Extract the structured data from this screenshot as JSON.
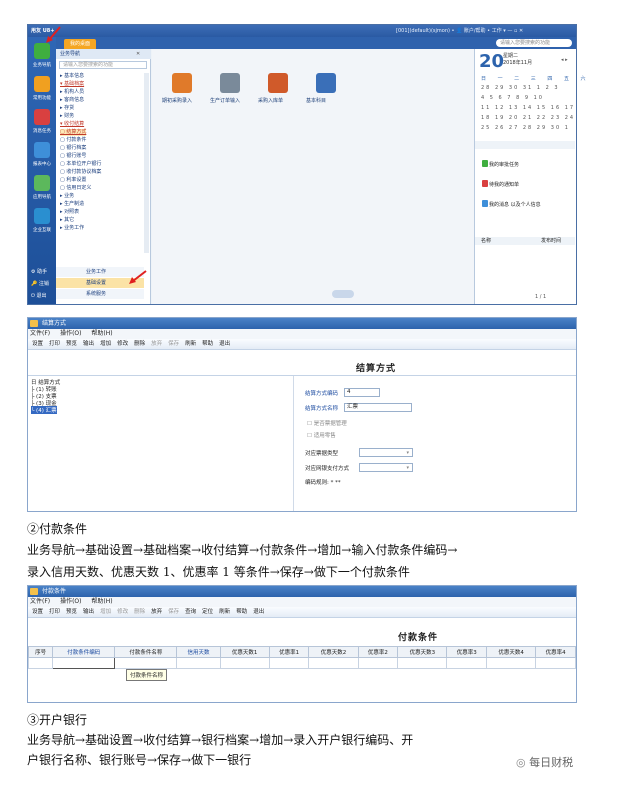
{
  "shot1": {
    "titlebar": {
      "app_name": "用友 U8+",
      "right_info": "[001](default)(sjmon) • 👤 账户/帮助 • 工作 ▾ — ▫ ✕",
      "search_placeholder": "请输入您要搜索的功能"
    },
    "sidebar": [
      {
        "label": "业务导航",
        "color": "#3fae3f"
      },
      {
        "label": "常用功能",
        "color": "#f0a020"
      },
      {
        "label": "消息任务",
        "color": "#d94040"
      },
      {
        "label": "报表中心",
        "color": "#3e8fd9"
      },
      {
        "label": "应用导航",
        "color": "#5cb85c"
      },
      {
        "label": "企业互联",
        "color": "#2a8fd0"
      }
    ],
    "sidebar_bottom": [
      "助手",
      "注销",
      "退出"
    ],
    "tab_label": "我的桌面",
    "nav": {
      "header": "业务导航",
      "search_placeholder": "请输入您要搜索的功能",
      "items": [
        "▸ 基本信息",
        "▾ 基础档案",
        "  ▸ 机构人员",
        "  ▸ 客商信息",
        "  ▸ 存货",
        "  ▸ 财务",
        "  ▾ 收付结算",
        "    ▢ 结算方式",
        "    ▢ 付款条件",
        "    ▢ 银行档案",
        "    ▢ 银行账号",
        "    ▢ 本单位开户银行",
        "    ▢ 收付款协议档案",
        "    ▢ 利率设置",
        "    ▢ 信用日定义",
        "  ▸ 业务",
        "  ▸ 生产制造",
        "  ▸ 对照表",
        "  ▸ 其它",
        "▸ 业务工作"
      ],
      "bottom_items": [
        "业务工作",
        "基础设置",
        "系统服务"
      ]
    },
    "main_icons": [
      {
        "label": "期初采购录入",
        "color": "#e07a2a"
      },
      {
        "label": "生产订单输入",
        "color": "#7a8a9a"
      },
      {
        "label": "采购入库单",
        "color": "#d05a2a"
      },
      {
        "label": "基本科目",
        "color": "#3a6fb8"
      }
    ],
    "calendar": {
      "day": "20",
      "weekday": "星期二",
      "month": "2018年11月",
      "weekdays": "日 一 二 三 四 五 六",
      "rows": [
        "28 29 30 31 1 2 3",
        "4 5 6 7 8 9 10",
        "11 12 13 14 15 16 17",
        "18 19 20 21 22 23 24",
        "25 26 27 28 29 30 1"
      ]
    },
    "tasks": [
      {
        "label": "我的审批任务",
        "color": "#3fae3f"
      },
      {
        "label": "待我的通知单",
        "color": "#d94040"
      },
      {
        "label": "我的消息 以及个人信息",
        "color": "#3e8fd9"
      }
    ],
    "right_footer": [
      "名称",
      "发布时间"
    ],
    "pager": "1 / 1"
  },
  "shot2": {
    "window_title": "结算方式",
    "menu": [
      "文件(F)",
      "操作(O)",
      "帮助(H)"
    ],
    "toolbar": [
      {
        "label": "设置",
        "enabled": true
      },
      {
        "label": "打印",
        "enabled": true
      },
      {
        "label": "预览",
        "enabled": true
      },
      {
        "label": "输出",
        "enabled": true
      },
      {
        "label": "增加",
        "enabled": true
      },
      {
        "label": "修改",
        "enabled": true
      },
      {
        "label": "删除",
        "enabled": true
      },
      {
        "label": "放弃",
        "enabled": false
      },
      {
        "label": "保存",
        "enabled": false
      },
      {
        "label": "刷新",
        "enabled": true
      },
      {
        "label": "帮助",
        "enabled": true
      },
      {
        "label": "退出",
        "enabled": true
      }
    ],
    "form_title": "结算方式",
    "tree": [
      "日 结算方式",
      "  ├ (1) 转账",
      "  ├ (2) 支票",
      "  ├ (3) 现金",
      "  └ (4) 汇票"
    ],
    "fields": {
      "code_label": "结算方式编码",
      "code_value": "4",
      "name_label": "结算方式名称",
      "name_value": "汇票",
      "check1": "是否票据管理",
      "check2": "适用零售",
      "bill_type_label": "对应票据类型",
      "net_bank_label": "对应网银支付方式",
      "encode_rule": "编码规则: * **"
    }
  },
  "text1": {
    "heading": "②付款条件",
    "line1": "业务导航→基础设置→基础档案→收付结算→付款条件→增加→输入付款条件编码→",
    "line2": "录入信用天数、优惠天数 1、优惠率 1 等条件→保存→做下一个付款条件"
  },
  "shot3": {
    "window_title": "付款条件",
    "menu": [
      "文件(F)",
      "操作(O)",
      "帮助(H)"
    ],
    "toolbar": [
      {
        "label": "设置",
        "enabled": true
      },
      {
        "label": "打印",
        "enabled": true
      },
      {
        "label": "预览",
        "enabled": true
      },
      {
        "label": "输出",
        "enabled": true
      },
      {
        "label": "增加",
        "enabled": false
      },
      {
        "label": "修改",
        "enabled": false
      },
      {
        "label": "删除",
        "enabled": false
      },
      {
        "label": "放弃",
        "enabled": true
      },
      {
        "label": "保存",
        "enabled": false
      },
      {
        "label": "查询",
        "enabled": true
      },
      {
        "label": "定位",
        "enabled": true
      },
      {
        "label": "刷新",
        "enabled": true
      },
      {
        "label": "帮助",
        "enabled": true
      },
      {
        "label": "退出",
        "enabled": true
      }
    ],
    "form_title": "付款条件",
    "columns": [
      "序号",
      "付款条件编码",
      "付款条件名称",
      "信用天数",
      "优惠天数1",
      "优惠率1",
      "优惠天数2",
      "优惠率2",
      "优惠天数3",
      "优惠率3",
      "优惠天数4",
      "优惠率4"
    ],
    "tooltip": "付款条件名称"
  },
  "text2": {
    "heading": "③开户银行",
    "line1": "业务导航→基础设置→收付结算→银行档案→增加→录入开户银行编码、开",
    "line2": "户银行名称、银行账号→保存→做下一银行"
  },
  "watermark": "每日财税",
  "colors": {
    "accent_blue": "#2d63ac",
    "tab_orange": "#f5a623",
    "arrow_red": "#e02020"
  }
}
